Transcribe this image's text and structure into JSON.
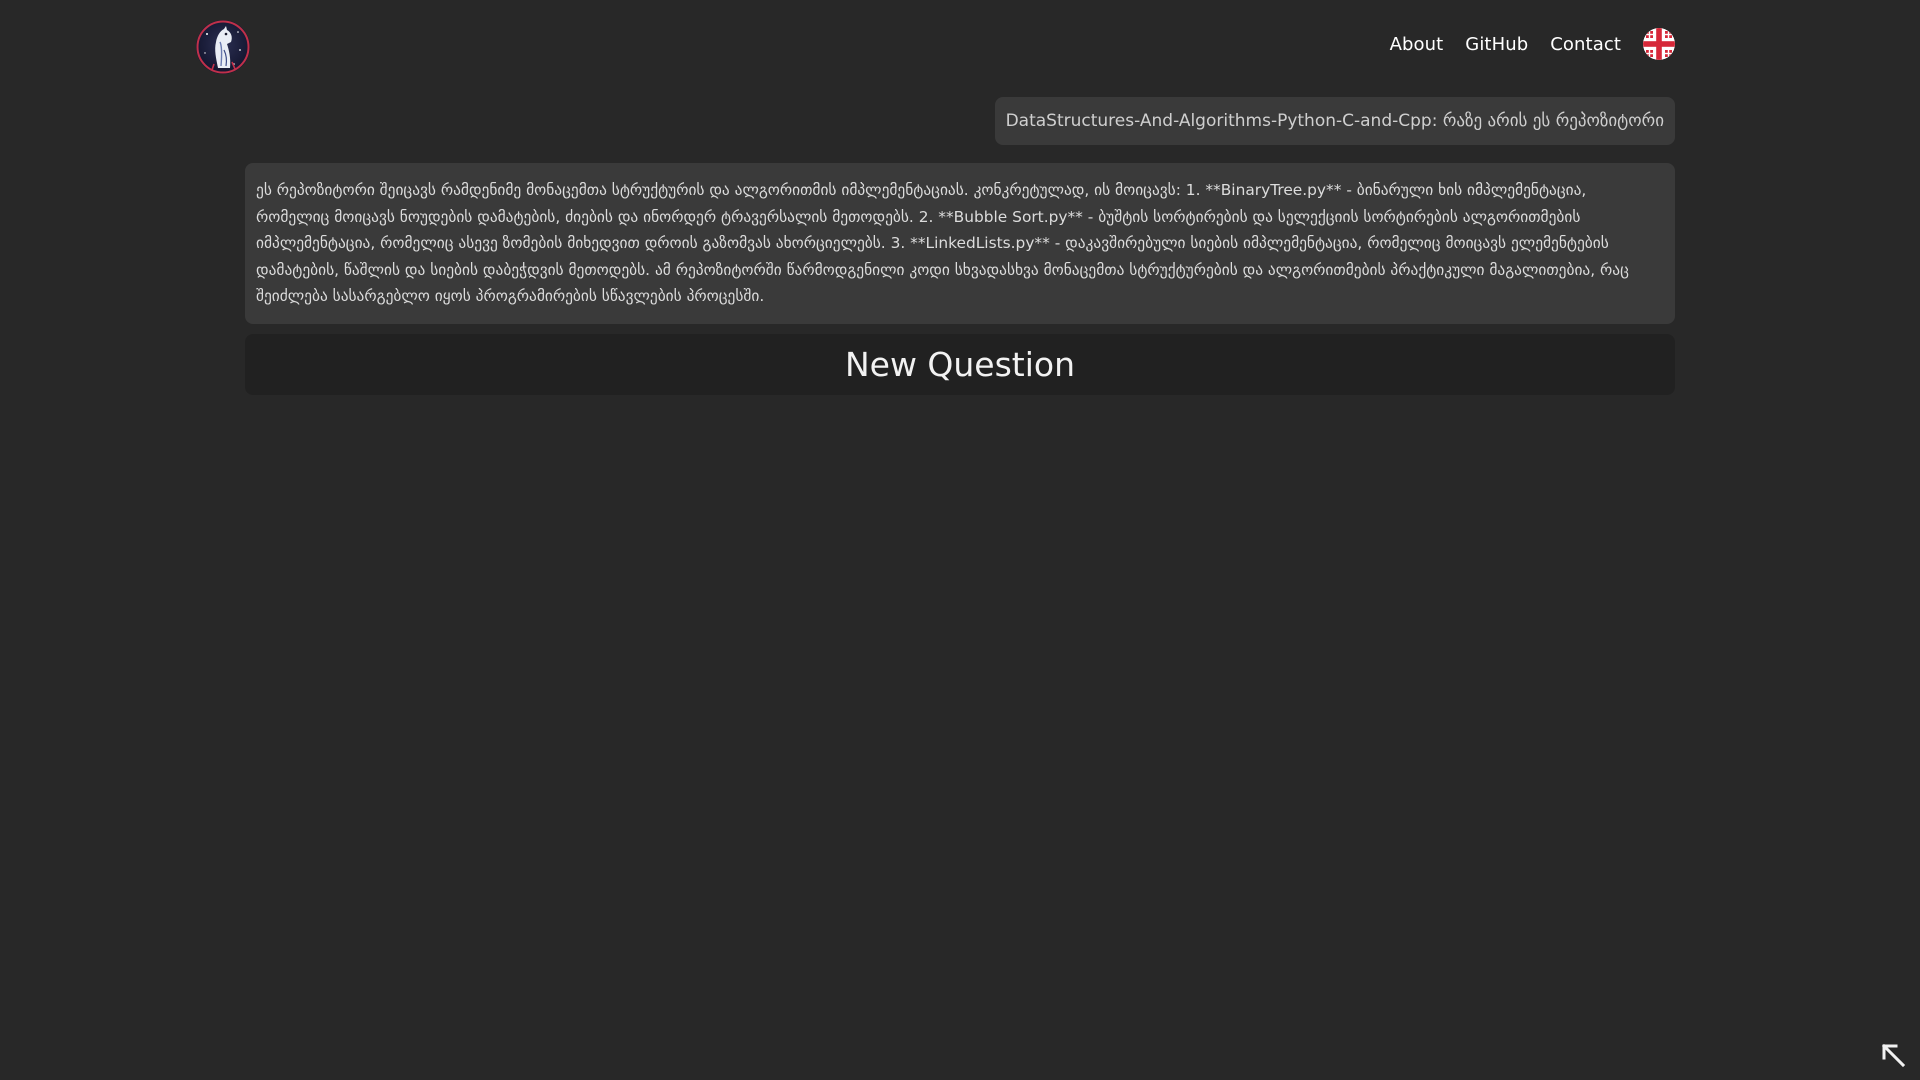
{
  "header": {
    "logo_icon": "llama-astronaut-logo-icon",
    "nav": {
      "about": "About",
      "github": "GitHub",
      "contact": "Contact"
    },
    "language_icon": "uk-flag-icon"
  },
  "chat": {
    "question": "DataStructures-And-Algorithms-Python-C-and-Cpp: რაზე არის ეს რეპოზიტორი",
    "answer": "ეს რეპოზიტორი შეიცავს რამდენიმე მონაცემთა სტრუქტურის და ალგორითმის იმპლემენტაციას. კონკრეტულად, ის მოიცავს: 1. **BinaryTree.py** - ბინარული ხის იმპლემენტაცია, რომელიც მოიცავს ნოუდების დამატების, ძიების და ინორდერ ტრავერსალის მეთოდებს. 2. **Bubble Sort.py** - ბუშტის სორტირების და სელექციის სორტირების ალგორითმების იმპლემენტაცია, რომელიც ასევე ზომების მიხედვით დროის გაზომვას ახორციელებს. 3. **LinkedLists.py** - დაკავშირებული სიების იმპლემენტაცია, რომელიც მოიცავს ელემენტების დამატების, წაშლის და სიების დაბეჭდვის მეთოდებს. ამ რეპოზიტორში წარმოდგენილი კოდი სხვადასხვა მონაცემთა სტრუქტურების და ალგორითმების პრაქტიკული მაგალითებია, რაც შეიძლება სასარგებლო იყოს პროგრამირების სწავლების პროცესში.",
    "new_question_label": "New Question"
  },
  "footer": {
    "scroll_icon": "arrow-up-left-icon"
  },
  "colors": {
    "background": "#282828",
    "bubble": "#3a3a3a",
    "button": "#212121",
    "text": "#ffffff"
  }
}
